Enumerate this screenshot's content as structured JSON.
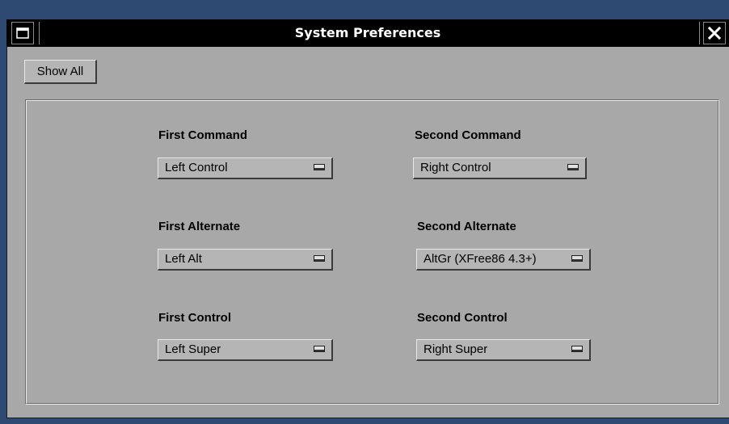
{
  "window": {
    "title": "System Preferences",
    "show_all_label": "Show All"
  },
  "preferences": {
    "first_command": {
      "label": "First Command",
      "value": "Left Control"
    },
    "second_command": {
      "label": "Second Command",
      "value": "Right Control"
    },
    "first_alternate": {
      "label": "First Alternate",
      "value": "Left Alt"
    },
    "second_alternate": {
      "label": "Second Alternate",
      "value": "AltGr (XFree86 4.3+)"
    },
    "first_control": {
      "label": "First Control",
      "value": "Left Super"
    },
    "second_control": {
      "label": "Second Control",
      "value": "Right Super"
    }
  },
  "icons": {
    "miniaturize": "miniaturize-icon",
    "close": "close-icon",
    "popup_arrow": "popup-arrow-icon"
  },
  "colors": {
    "desktop": "#2e4a73",
    "titlebar": "#000000",
    "window_bg": "#a8a8a8",
    "button_bg": "#b5b5b5"
  }
}
